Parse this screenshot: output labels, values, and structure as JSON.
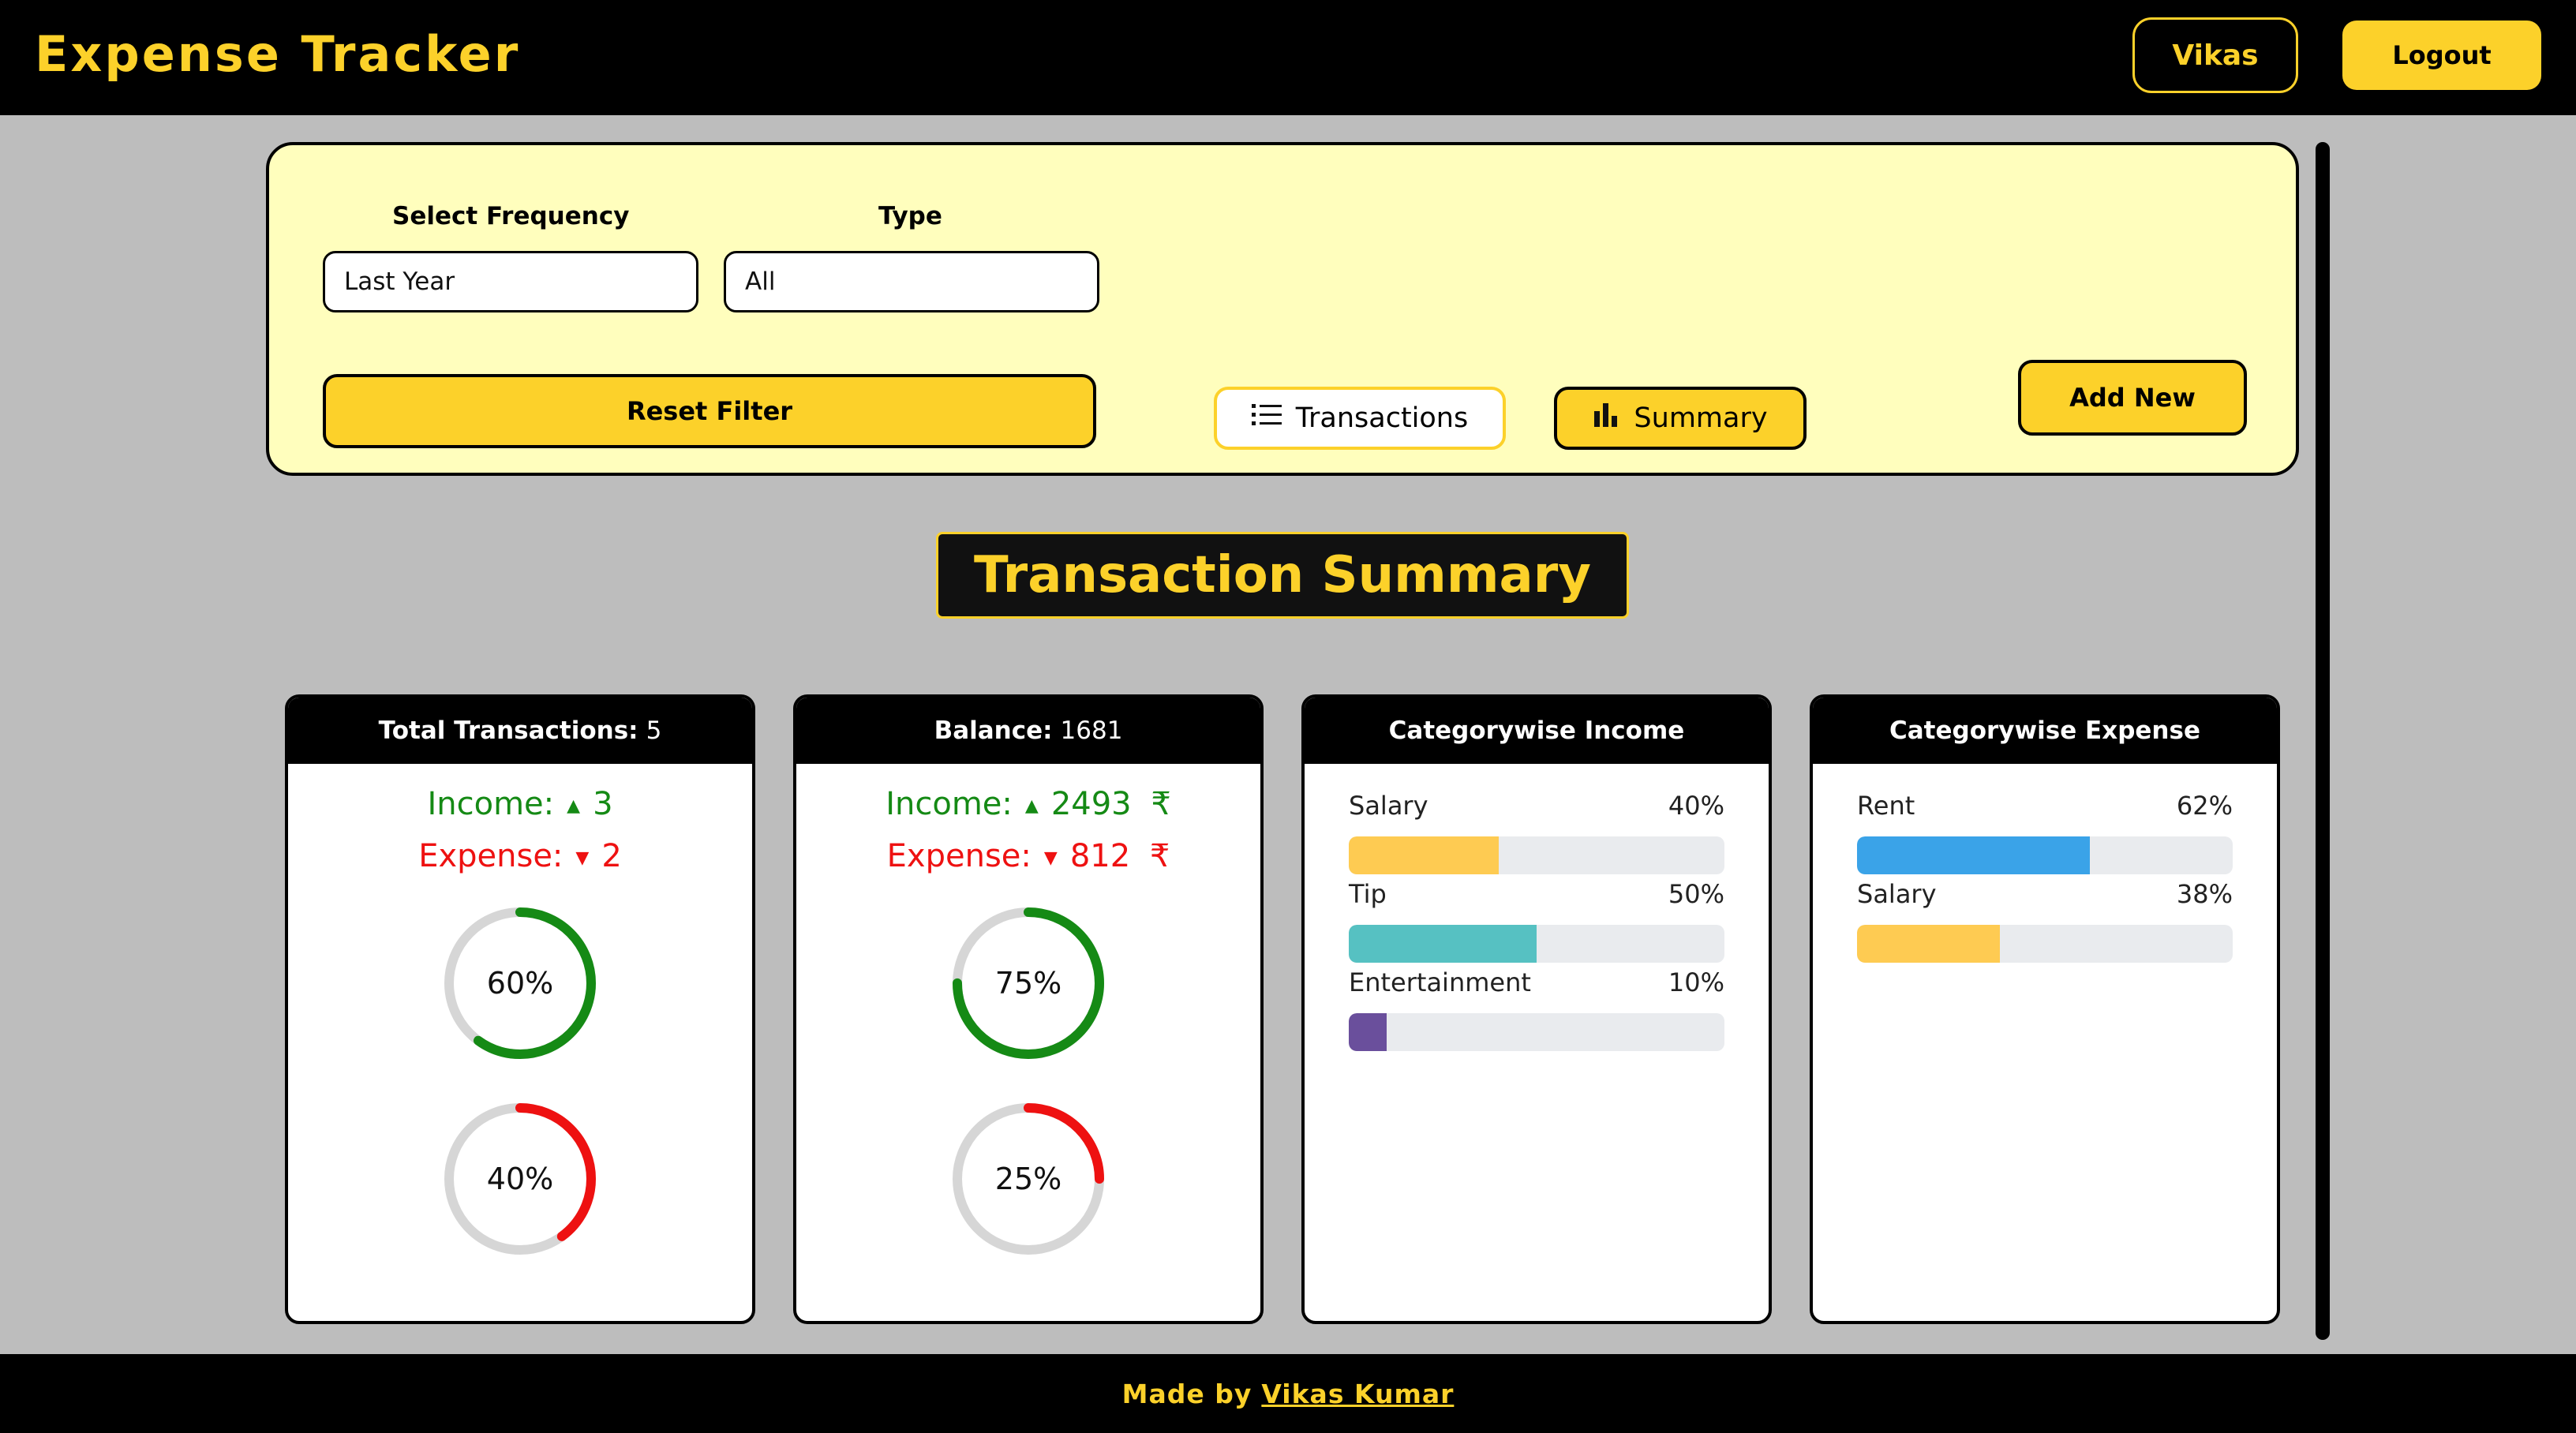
{
  "header": {
    "title": "Expense Tracker",
    "user_label": "Vikas",
    "logout_label": "Logout"
  },
  "filters": {
    "frequency_label": "Select Frequency",
    "frequency_value": "Last Year",
    "type_label": "Type",
    "type_value": "All",
    "reset_label": "Reset Filter",
    "view_transactions_label": "Transactions",
    "view_summary_label": "Summary",
    "add_new_label": "Add New"
  },
  "summary_title": "Transaction Summary",
  "cards": {
    "total": {
      "title": "Total Transactions:",
      "value": "5",
      "income_label": "Income:",
      "income_value": "3",
      "expense_label": "Expense:",
      "expense_value": "2",
      "income_percent": 60,
      "income_percent_label": "60%",
      "expense_percent": 40,
      "expense_percent_label": "40%"
    },
    "balance": {
      "title": "Balance:",
      "value": "1681",
      "income_label": "Income:",
      "income_value": "2493",
      "expense_label": "Expense:",
      "expense_value": "812",
      "currency": "₹",
      "income_percent": 75,
      "income_percent_label": "75%",
      "expense_percent": 25,
      "expense_percent_label": "25%"
    },
    "income_categories": {
      "title": "Categorywise Income",
      "items": [
        {
          "name": "Salary",
          "percent_label": "40%",
          "percent": 40,
          "color": "#fecb52"
        },
        {
          "name": "Tip",
          "percent_label": "50%",
          "percent": 50,
          "color": "#56c1c2"
        },
        {
          "name": "Entertainment",
          "percent_label": "10%",
          "percent": 10,
          "color": "#6a4f9c"
        }
      ]
    },
    "expense_categories": {
      "title": "Categorywise Expense",
      "items": [
        {
          "name": "Rent",
          "percent_label": "62%",
          "percent": 62,
          "color": "#3aa3e8"
        },
        {
          "name": "Salary",
          "percent_label": "38%",
          "percent": 38,
          "color": "#fecb52"
        }
      ]
    }
  },
  "colors": {
    "accent": "#fcd12a",
    "income": "#158a15",
    "expense": "#ee1111",
    "track": "#d6d6d6"
  },
  "footer": {
    "prefix": "Made by",
    "author": "Vikas Kumar"
  }
}
